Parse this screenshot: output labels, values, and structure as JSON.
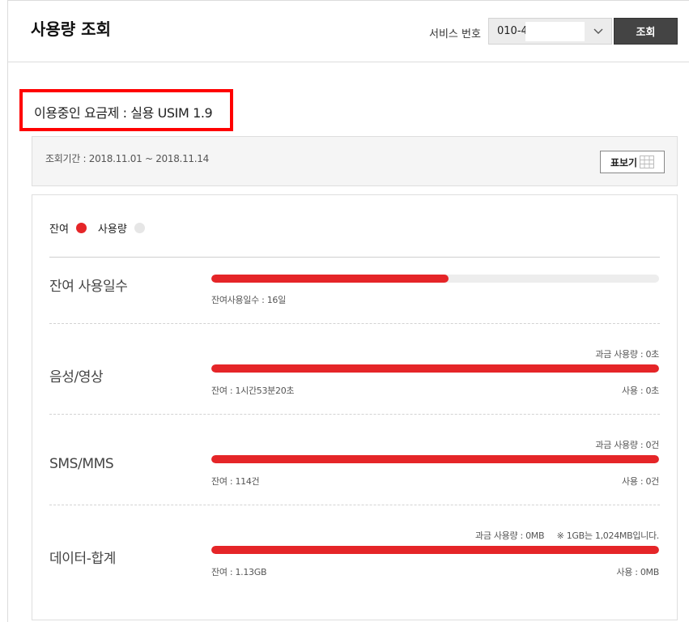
{
  "header": {
    "title": "사용량 조회",
    "service_label": "서비스 번호",
    "service_value": "010-4",
    "query_button": "조회"
  },
  "plan": {
    "text": "이용중인 요금제 : 실용 USIM 1.9"
  },
  "period": {
    "text": "조회기간 : 2018.11.01 ~ 2018.11.14",
    "table_button": "표보기"
  },
  "legend": {
    "remaining": "잔여",
    "used": "사용량",
    "remaining_color": "#e52528",
    "used_color": "#e6e6e6"
  },
  "rows": [
    {
      "label": "잔여 사용일수",
      "remaining_fraction": 0.53,
      "left_note": "잔여사용일수 : 16일"
    },
    {
      "label": "음성/영상",
      "remaining_fraction": 1.0,
      "top_note": "과금 사용량 : 0초",
      "left_note": "잔여 : 1시간53분20초",
      "right_note": "사용 : 0초"
    },
    {
      "label": "SMS/MMS",
      "remaining_fraction": 1.0,
      "top_note": "과금 사용량 : 0건",
      "left_note": "잔여 : 114건",
      "right_note": "사용 : 0건"
    },
    {
      "label": "데이터-합계",
      "remaining_fraction": 1.0,
      "top_note": "과금 사용량 : 0MB",
      "extra_note": "※ 1GB는 1,024MB입니다.",
      "left_note": "잔여 : 1.13GB",
      "right_note": "사용 : 0MB"
    }
  ]
}
